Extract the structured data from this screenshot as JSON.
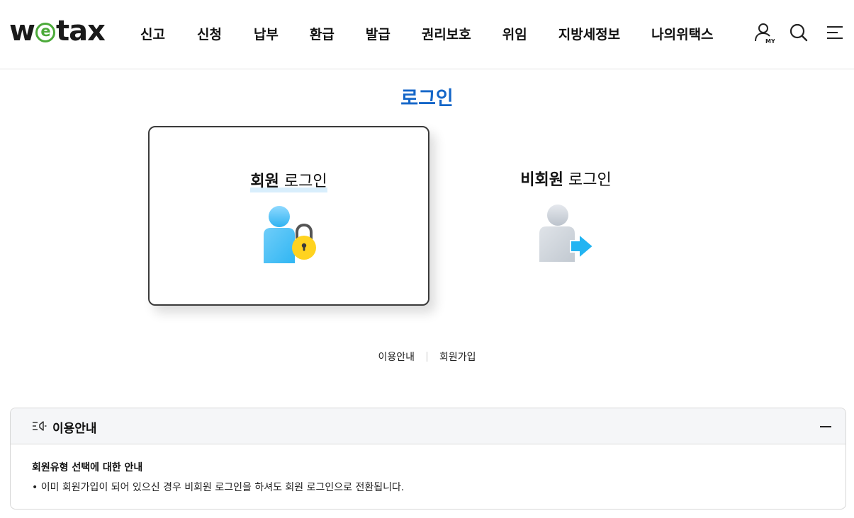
{
  "header": {
    "logo": {
      "part1": "w",
      "part2": "e",
      "part3": "tax"
    },
    "nav": [
      "신고",
      "신청",
      "납부",
      "환급",
      "발급",
      "권리보호",
      "위임",
      "지방세정보",
      "나의위택스"
    ],
    "icons": {
      "my": "user-my-icon",
      "my_label": "MY",
      "search": "search-icon",
      "menu": "hamburger-menu-icon"
    }
  },
  "page": {
    "title": "로그인"
  },
  "cards": [
    {
      "bold": "회원",
      "rest": " 로그인",
      "icon": "member-lock-icon",
      "selected": true
    },
    {
      "bold": "비회원",
      "rest": " 로그인",
      "icon": "guest-arrow-icon",
      "selected": false
    }
  ],
  "links": [
    "이용안내",
    "회원가입"
  ],
  "info": {
    "title": "이용안내",
    "subtitle": "회원유형 선택에 대한 안내",
    "item": "• 이미 회원가입이 되어 있으신 경우 비회원 로그인을 하셔도 회원 로그인으로 전환됩니다."
  },
  "colors": {
    "accent": "#1466c8",
    "logo_green": "#4caa3a",
    "card_icon_blue": "#39bdf5",
    "lock_yellow": "#ffd320"
  }
}
